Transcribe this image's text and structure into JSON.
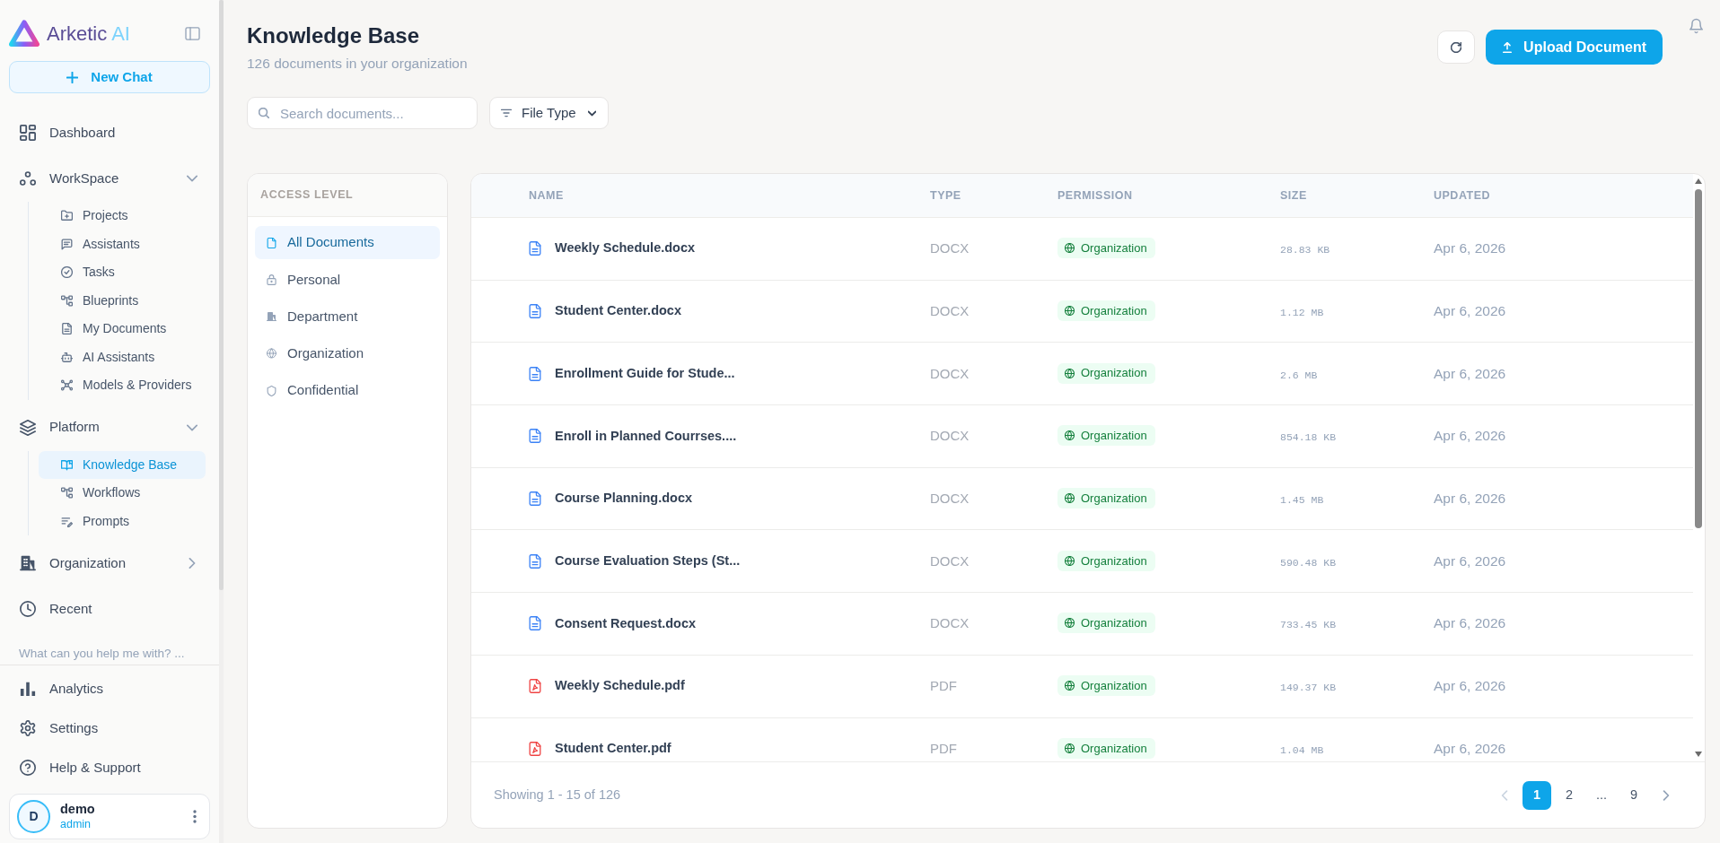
{
  "sidebar": {
    "brand": {
      "name": "Arketic",
      "accent": "AI"
    },
    "new_chat": {
      "label": "New Chat"
    },
    "nav": [
      {
        "kind": "link",
        "label": "Dashboard",
        "selected": false
      },
      {
        "kind": "group",
        "label": "WorkSpace",
        "selected": false,
        "expanded": true,
        "children": [
          {
            "label": "Projects",
            "selected": false
          },
          {
            "label": "Assistants",
            "selected": false
          },
          {
            "label": "Tasks",
            "selected": false
          },
          {
            "label": "Blueprints",
            "selected": false
          },
          {
            "label": "My Documents",
            "selected": false
          },
          {
            "label": "AI Assistants",
            "selected": false
          },
          {
            "label": "Models & Providers",
            "selected": false
          }
        ]
      },
      {
        "kind": "group",
        "label": "Platform",
        "selected": false,
        "expanded": true,
        "children": [
          {
            "label": "Knowledge Base",
            "selected": true
          },
          {
            "label": "Workflows",
            "selected": false
          },
          {
            "label": "Prompts",
            "selected": false
          }
        ]
      },
      {
        "kind": "group",
        "label": "Organization",
        "selected": false,
        "expanded": false
      },
      {
        "kind": "link",
        "label": "Recent",
        "selected": false
      }
    ],
    "recent_chats": [
      {
        "label": "What can you help me with? ..."
      }
    ],
    "bottom_nav": [
      {
        "label": "Analytics",
        "selected": false
      },
      {
        "label": "Settings",
        "selected": false
      },
      {
        "label": "Help & Support",
        "selected": false
      }
    ],
    "user": {
      "initial": "D",
      "name": "demo",
      "role": "admin"
    }
  },
  "header": {
    "title": "Knowledge Base",
    "subtitle": "126 documents in your organization",
    "upload_button": {
      "label": "Upload Document"
    }
  },
  "filters": {
    "search": {
      "placeholder": "Search documents..."
    },
    "file_type": {
      "label": "File Type"
    }
  },
  "access_level": {
    "title": "ACCESS LEVEL",
    "items": [
      {
        "label": "All Documents",
        "selected": true
      },
      {
        "label": "Personal",
        "selected": false
      },
      {
        "label": "Department",
        "selected": false
      },
      {
        "label": "Organization",
        "selected": false
      },
      {
        "label": "Confidential",
        "selected": false
      }
    ]
  },
  "table": {
    "columns": [
      "NAME",
      "TYPE",
      "PERMISSION",
      "SIZE",
      "UPDATED"
    ],
    "rows": [
      {
        "kind": "docx",
        "name": "Weekly Schedule.docx",
        "type": "DOCX",
        "permission": "Organization",
        "size": "28.83 KB",
        "updated": "Apr 6, 2026"
      },
      {
        "kind": "docx",
        "name": "Student Center.docx",
        "type": "DOCX",
        "permission": "Organization",
        "size": "1.12 MB",
        "updated": "Apr 6, 2026"
      },
      {
        "kind": "docx",
        "name": "Enrollment Guide for Stude...",
        "type": "DOCX",
        "permission": "Organization",
        "size": "2.6 MB",
        "updated": "Apr 6, 2026"
      },
      {
        "kind": "docx",
        "name": "Enroll in Planned Courrses....",
        "type": "DOCX",
        "permission": "Organization",
        "size": "854.18 KB",
        "updated": "Apr 6, 2026"
      },
      {
        "kind": "docx",
        "name": "Course Planning.docx",
        "type": "DOCX",
        "permission": "Organization",
        "size": "1.45 MB",
        "updated": "Apr 6, 2026"
      },
      {
        "kind": "docx",
        "name": "Course Evaluation Steps (St...",
        "type": "DOCX",
        "permission": "Organization",
        "size": "590.48 KB",
        "updated": "Apr 6, 2026"
      },
      {
        "kind": "docx",
        "name": "Consent Request.docx",
        "type": "DOCX",
        "permission": "Organization",
        "size": "733.45 KB",
        "updated": "Apr 6, 2026"
      },
      {
        "kind": "pdf",
        "name": "Weekly Schedule.pdf",
        "type": "PDF",
        "permission": "Organization",
        "size": "149.37 KB",
        "updated": "Apr 6, 2026"
      },
      {
        "kind": "pdf",
        "name": "Student Center.pdf",
        "type": "PDF",
        "permission": "Organization",
        "size": "1.04 MB",
        "updated": "Apr 6, 2026"
      }
    ]
  },
  "pagination": {
    "summary": "Showing 1 - 15 of 126",
    "previous": {
      "disabled": true
    },
    "next": {
      "disabled": false
    },
    "pages": [
      {
        "kind": "page",
        "label": "1",
        "selected": true
      },
      {
        "kind": "page",
        "label": "2",
        "selected": false
      },
      {
        "kind": "gap",
        "label": "...",
        "selected": false
      },
      {
        "kind": "page",
        "label": "9",
        "selected": false
      }
    ]
  }
}
